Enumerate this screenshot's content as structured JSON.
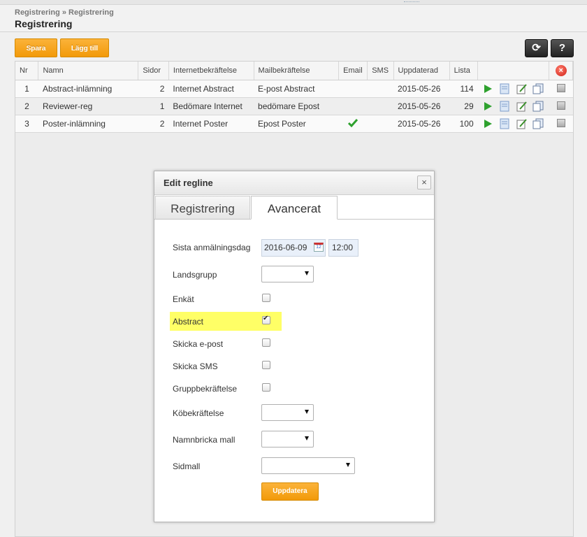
{
  "breadcrumb": "Registrering » Registrering",
  "page_title": "Registrering",
  "toolbar": {
    "save_label": "Spara",
    "add_label": "Lägg till"
  },
  "table": {
    "headers": [
      "Nr",
      "Namn",
      "Sidor",
      "Internetbekräftelse",
      "Mailbekräftelse",
      "Email",
      "SMS",
      "Uppdaterad",
      "Lista"
    ],
    "rows": [
      {
        "nr": "1",
        "namn": "Abstract-inlämning",
        "sidor": "2",
        "internet": "Internet Abstract",
        "mail": "E-post Abstract",
        "email_check": false,
        "uppdaterad": "2015-05-26",
        "lista": "114"
      },
      {
        "nr": "2",
        "namn": "Reviewer-reg",
        "sidor": "1",
        "internet": "Bedömare Internet",
        "mail": "bedömare Epost",
        "email_check": false,
        "uppdaterad": "2015-05-26",
        "lista": "29"
      },
      {
        "nr": "3",
        "namn": "Poster-inlämning",
        "sidor": "2",
        "internet": "Internet Poster",
        "mail": "Epost Poster",
        "email_check": true,
        "uppdaterad": "2015-05-26",
        "lista": "100"
      }
    ]
  },
  "dialog": {
    "title": "Edit regline",
    "close_glyph": "×",
    "tabs": [
      "Registrering",
      "Avancerat"
    ],
    "active_tab": "Avancerat",
    "fields": {
      "sista_label": "Sista anmälningsdag",
      "date_value": "2016-06-09",
      "time_value": "12:00",
      "landsgrupp_label": "Landsgrupp",
      "enkat_label": "Enkät",
      "abstract_label": "Abstract",
      "skicka_epost_label": "Skicka e-post",
      "skicka_sms_label": "Skicka SMS",
      "gruppbekraftelse_label": "Gruppbekräftelse",
      "kobekraftelse_label": "Köbekräftelse",
      "namnbricka_label": "Namnbricka mall",
      "sidmall_label": "Sidmall"
    },
    "checkbox_states": {
      "enkat": false,
      "abstract": true,
      "skicka_epost": false,
      "skicka_sms": false,
      "gruppbekraftelse": false
    },
    "update_label": "Uppdatera"
  },
  "colors": {
    "accent": "#f29a09",
    "highlight": "#ffff66",
    "link": "#2c2c8c",
    "play": "#2ea12e"
  }
}
